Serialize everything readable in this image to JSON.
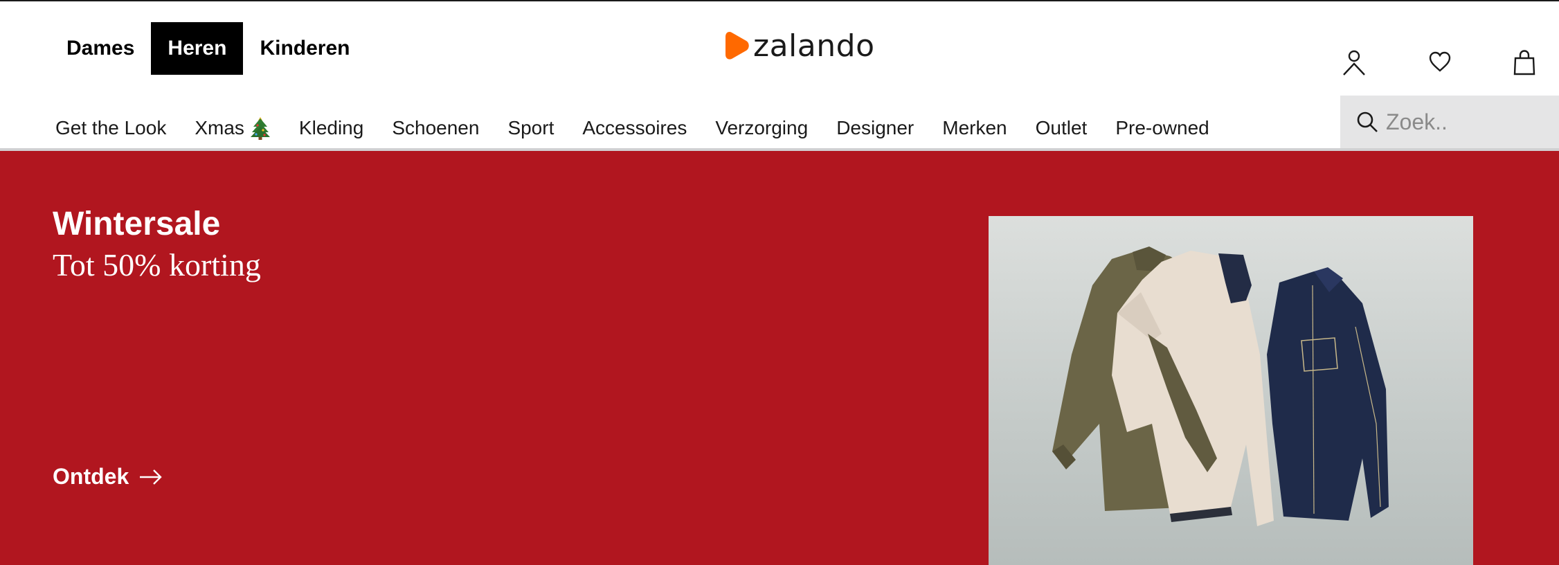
{
  "gender_nav": {
    "items": [
      {
        "label": "Dames",
        "active": false
      },
      {
        "label": "Heren",
        "active": true
      },
      {
        "label": "Kinderen",
        "active": false
      }
    ]
  },
  "logo": {
    "text": "zalando",
    "accent_color": "#ff6900"
  },
  "header_icons": [
    "user-icon",
    "heart-icon",
    "shopping-bag-icon"
  ],
  "category_nav": {
    "items": [
      {
        "label": "Get the Look"
      },
      {
        "label": "Xmas",
        "icon": "christmas-tree-icon"
      },
      {
        "label": "Kleding"
      },
      {
        "label": "Schoenen"
      },
      {
        "label": "Sport"
      },
      {
        "label": "Accessoires"
      },
      {
        "label": "Verzorging"
      },
      {
        "label": "Designer"
      },
      {
        "label": "Merken"
      },
      {
        "label": "Outlet"
      },
      {
        "label": "Pre-owned"
      }
    ]
  },
  "search": {
    "placeholder": "Zoek..",
    "value": ""
  },
  "hero": {
    "title": "Wintersale",
    "subtitle": "Tot 50% korting",
    "cta_label": "Ontdek",
    "background_color": "#b1161f",
    "image": "hanging-jackets-photo"
  }
}
